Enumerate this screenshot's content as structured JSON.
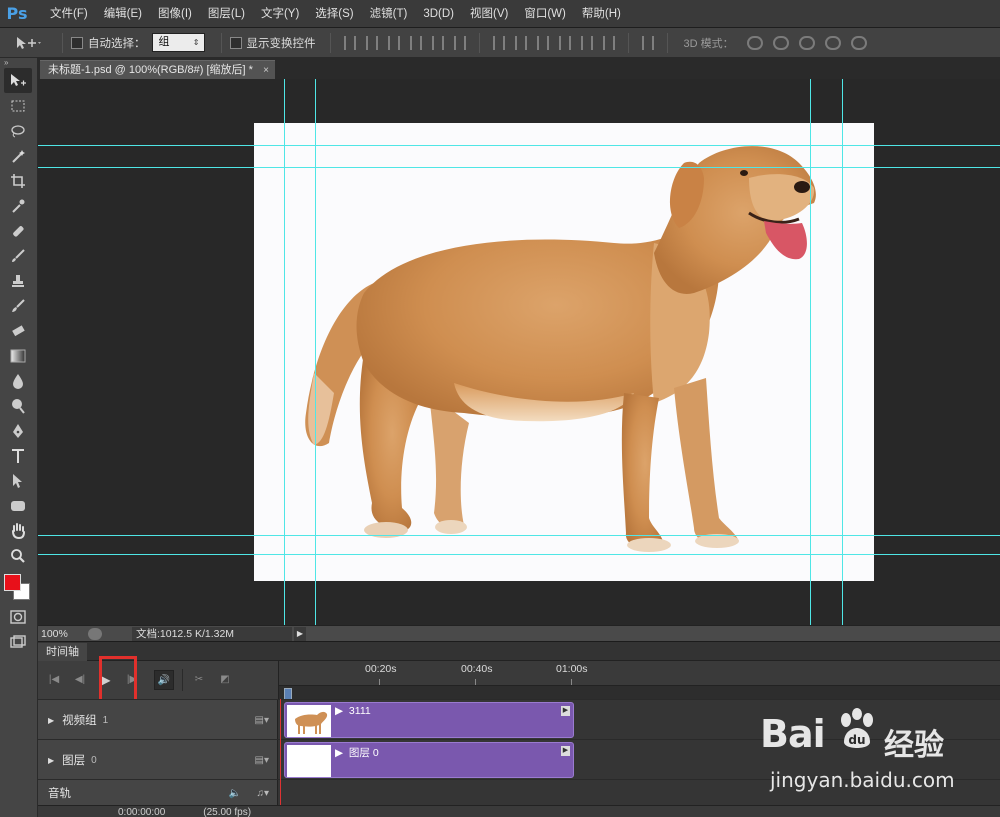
{
  "app": {
    "logo": "Ps"
  },
  "menu": [
    "文件(F)",
    "编辑(E)",
    "图像(I)",
    "图层(L)",
    "文字(Y)",
    "选择(S)",
    "滤镜(T)",
    "3D(D)",
    "视图(V)",
    "窗口(W)",
    "帮助(H)"
  ],
  "options": {
    "auto_select_label": "自动选择：",
    "auto_select_value": "组",
    "show_transform_label": "显示变换控件",
    "mode_3d_label": "3D 模式："
  },
  "document": {
    "tab_title": "未标题-1.psd @ 100%(RGB/8#) [缩放后] *",
    "close": "×"
  },
  "status": {
    "zoom": "100%",
    "doc_info": "文档:1012.5 K/1.32M"
  },
  "timeline": {
    "tab": "时间轴",
    "ruler": [
      "00:20s",
      "00:40s",
      "01:00s"
    ],
    "tracks": [
      {
        "name": "视频组",
        "num": "1",
        "clip": "3111"
      },
      {
        "name": "图层",
        "num": "0",
        "clip": "图层 0"
      }
    ],
    "audio_track": "音轨",
    "timecode": "0:00:00:00",
    "fps": "(25.00 fps)"
  },
  "watermark": {
    "logo": "Bai",
    "brand": "经验",
    "url": "jingyan.baidu.com"
  },
  "colors": {
    "foreground": "#e8101a",
    "background": "#ffffff",
    "guide": "#4fe6e6",
    "clip": "#7a58ae",
    "highlight": "#e1302c"
  }
}
